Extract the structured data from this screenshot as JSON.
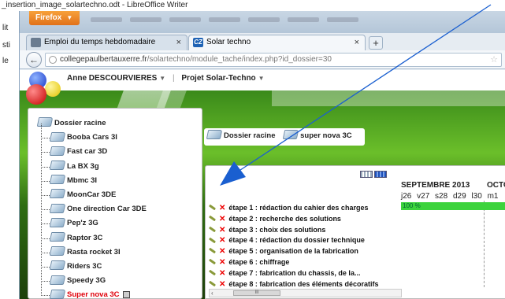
{
  "writer": {
    "title": "_insertion_image_solartechno.odt - LibreOffice Writer",
    "side_fragments": [
      "lit",
      "sti",
      "le"
    ]
  },
  "firefox": {
    "menu_button": "Firefox",
    "tabs": [
      {
        "label": "Emploi du temps hebdomadaire",
        "close": "×"
      },
      {
        "label": "Solar techno",
        "close": "×",
        "icon_text": "CZ"
      }
    ],
    "new_tab": "+",
    "url_host": "collegepaulbertauxerre.fr",
    "url_path": "/solartechno/module_tache/index.php?id_dossier=30"
  },
  "site": {
    "user_name": "Anne DESCOURVIERES",
    "project_name": "Projet Solar-Techno"
  },
  "tree": {
    "root": "Dossier racine",
    "items": [
      "Booba Cars 3I",
      "Fast car 3D",
      "La BX 3g",
      "Mbmc 3I",
      "MoonCar 3DE",
      "One direction Car 3DE",
      "Pep'z 3G",
      "Raptor 3C",
      "Rasta rocket 3I",
      "Riders 3C",
      "Speedy 3G"
    ],
    "selected": "Super nova 3C"
  },
  "breadcrumb": {
    "root": "Dossier racine",
    "current": "super nova 3C"
  },
  "gantt": {
    "month1": "SEPTEMBRE 2013",
    "month2": "OCTO",
    "weeks": [
      "j26",
      "v27",
      "s28",
      "d29",
      "l30",
      "m1"
    ],
    "progress_label": "100 %",
    "progress_value": 100,
    "tasks": [
      "étape 1 : rédaction du cahier des charges",
      "étape 2 : recherche des solutions",
      "étape 3 : choix des solutions",
      "étape 4 : rédaction du dossier technique",
      "étape 5 : organisation de la fabrication",
      "étape 6 : chiffrage",
      "étape 7 : fabrication du chassis, de la...",
      "étape 8 : fabrication des éléments décoratifs"
    ],
    "scroll_left": "‹",
    "scroll_thumb": "III"
  },
  "colors": {
    "accent_red": "#e0000a",
    "progress_green": "#3cd33c",
    "firefox_orange": "#e1711a",
    "arrow_blue": "#1a5fd0"
  }
}
